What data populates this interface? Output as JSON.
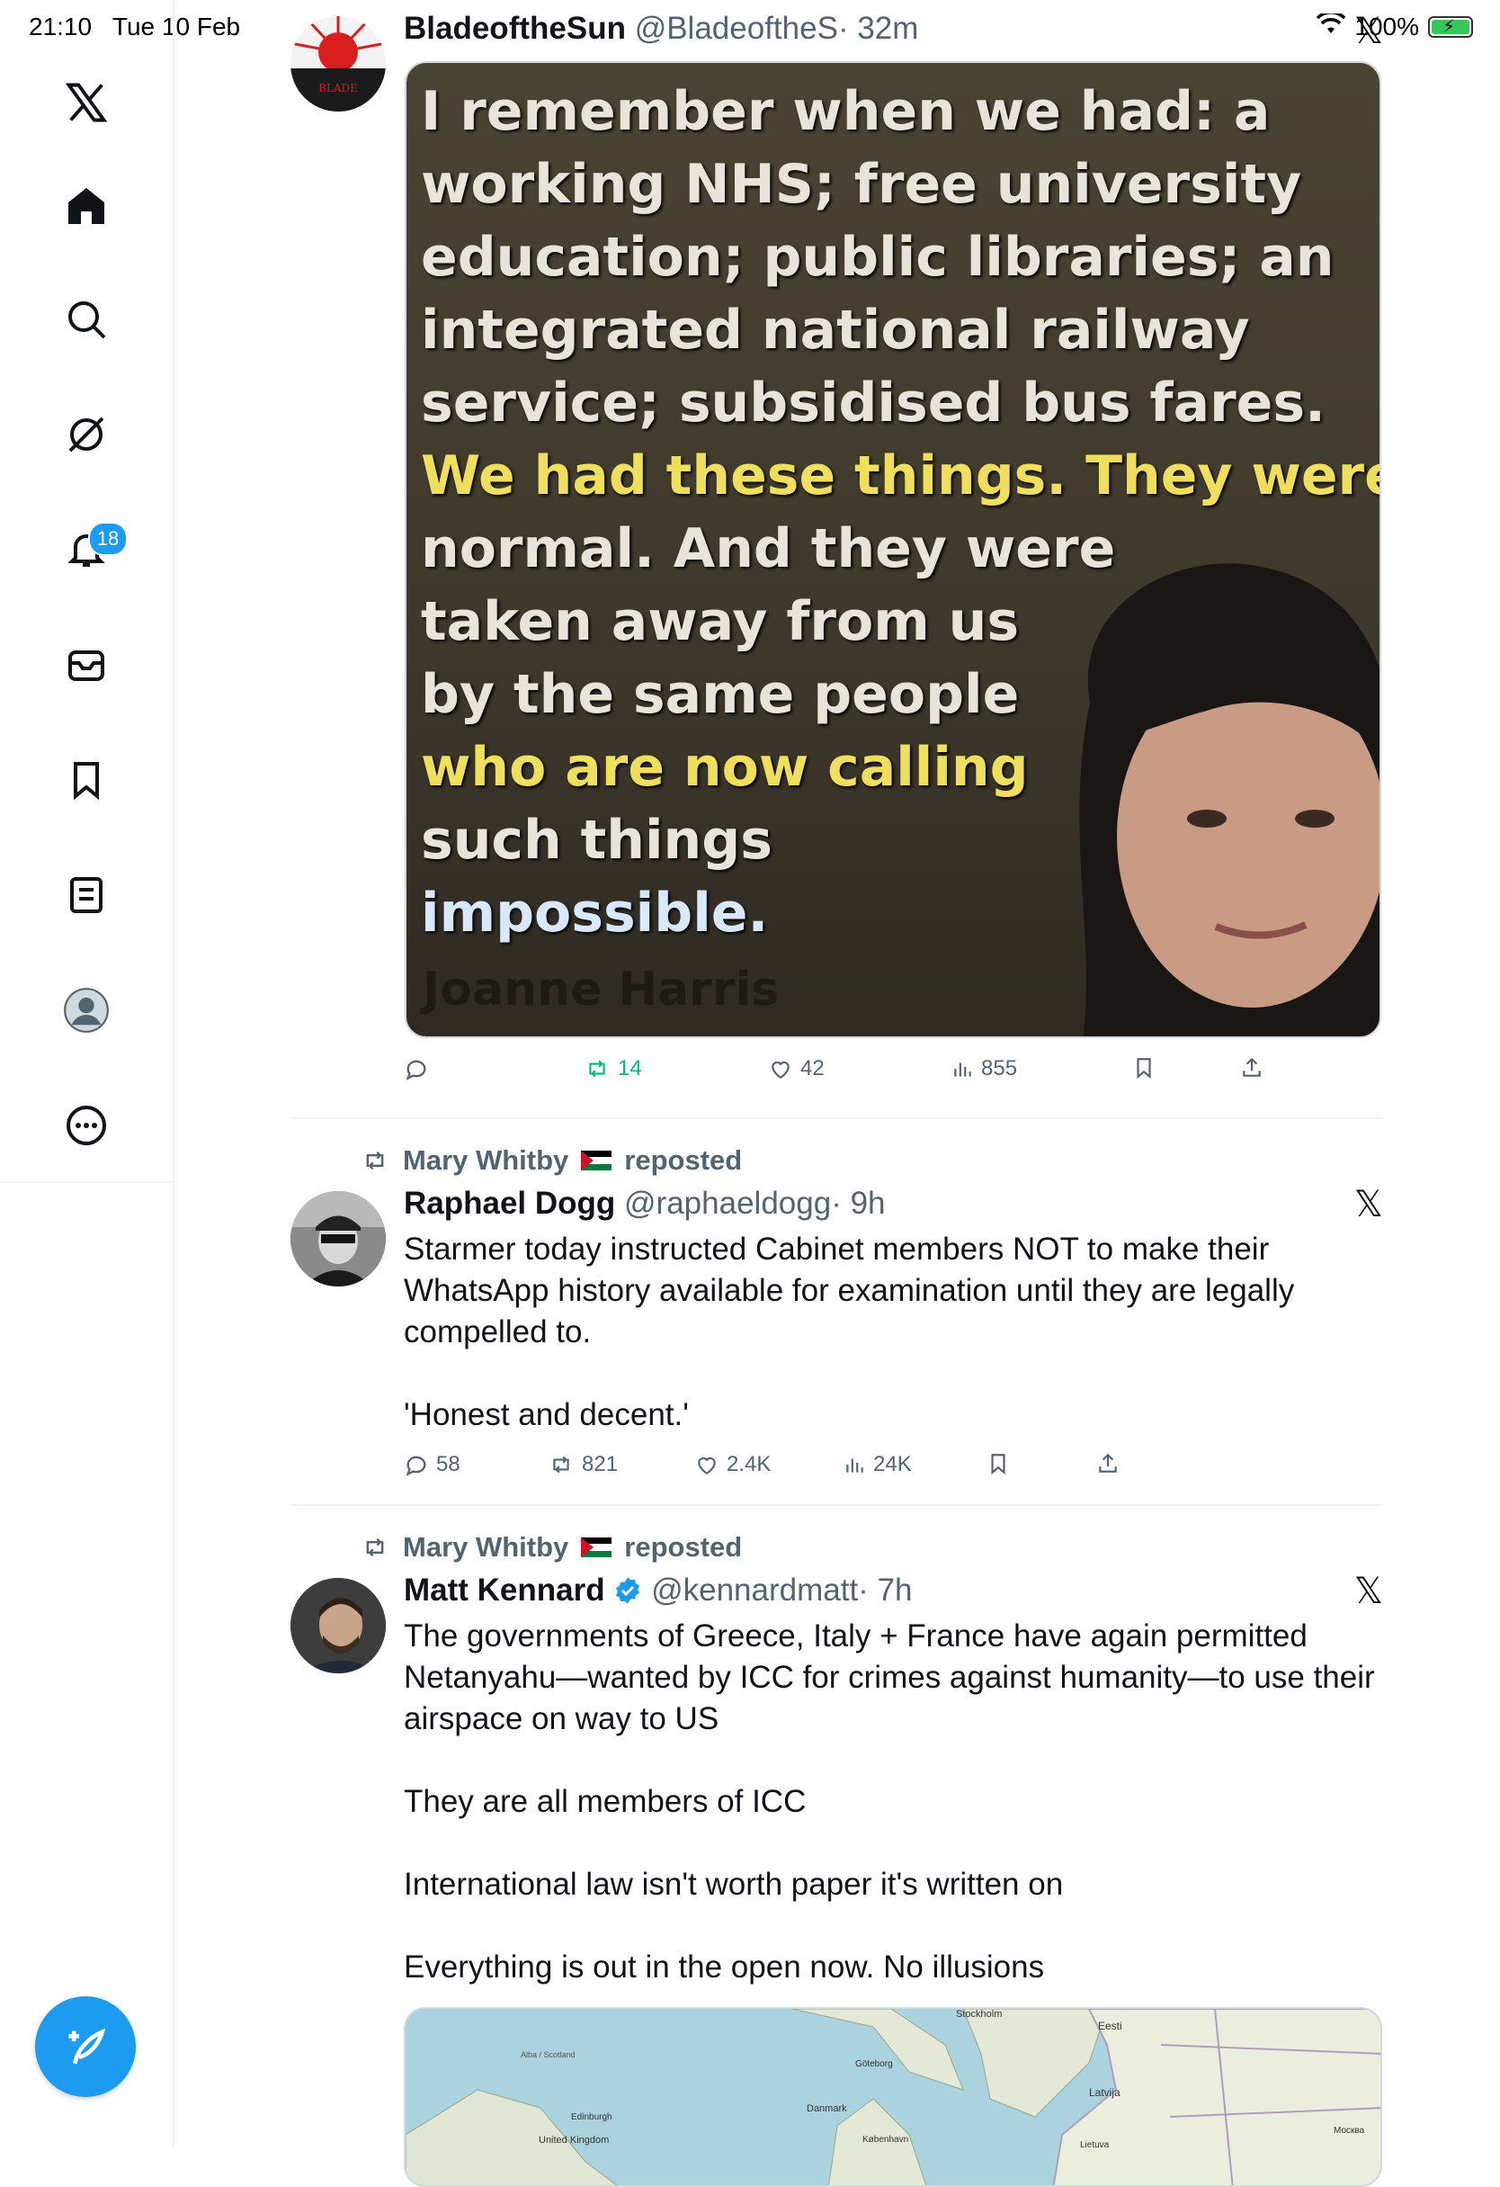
{
  "status_bar": {
    "time": "21:10",
    "date": "Tue 10 Feb",
    "battery": "100%",
    "battery_level": 1.0
  },
  "sidebar": {
    "notifications_badge": "18",
    "items": [
      "x-logo",
      "home",
      "search",
      "grok",
      "notifications",
      "messages",
      "bookmarks",
      "lists",
      "profile",
      "more"
    ]
  },
  "tweets": [
    {
      "name": "BladeoftheSun",
      "handle": "@BladeoftheS",
      "time": "· 32m",
      "image": {
        "lines": [
          {
            "text": "I remember when we had: a",
            "color": "white"
          },
          {
            "text": "working NHS; free university",
            "color": "white"
          },
          {
            "text": "education; public libraries; an",
            "color": "white"
          },
          {
            "text": "integrated national railway",
            "color": "white"
          },
          {
            "text": "service; subsidised bus fares.",
            "color": "white"
          },
          {
            "text": "We had these things. They were",
            "color": "yellow"
          },
          {
            "text": "normal. And they were",
            "color": "white"
          },
          {
            "text": "taken away from us",
            "color": "white"
          },
          {
            "text": "by the same people",
            "color": "white"
          },
          {
            "text": "who are now calling",
            "color": "yellow"
          },
          {
            "text": "such things",
            "color": "white"
          },
          {
            "text": "impossible.",
            "color": "blue"
          }
        ],
        "author": "Joanne Harris"
      },
      "stats": {
        "replies": "",
        "reposts": "14",
        "likes": "42",
        "views": "855"
      }
    },
    {
      "reposted_by": "Mary Whitby",
      "reposted_label": "reposted",
      "name": "Raphael Dogg",
      "handle": "@raphaeldogg",
      "time": "· 9h",
      "text": [
        "Starmer today instructed Cabinet members NOT  to make their WhatsApp history available for examination until they are legally compelled to.",
        "'Honest and decent.'"
      ],
      "stats": {
        "replies": "58",
        "reposts": "821",
        "likes": "2.4K",
        "views": "24K"
      }
    },
    {
      "reposted_by": "Mary Whitby",
      "reposted_label": "reposted",
      "name": "Matt Kennard",
      "handle": "@kennardmatt",
      "time": "· 7h",
      "verified": true,
      "text": [
        "The governments of Greece, Italy + France have again permitted Netanyahu—wanted by ICC for crimes against humanity—to use their airspace on way to US",
        "They are all members of ICC",
        "International law isn't worth paper it's written on",
        "Everything is out in the open now. No illusions"
      ],
      "map_labels": [
        "Stockholm",
        "Eesti",
        "Latvija",
        "Danmark",
        "København",
        "Edinburgh",
        "United Kingdom",
        "Göteborg",
        "Alba / Scotland",
        "Lietuva",
        "Москва"
      ]
    }
  ],
  "colors": {
    "accent": "#1d9bf0",
    "repost_green": "#00ba7c",
    "muted": "#536471"
  }
}
